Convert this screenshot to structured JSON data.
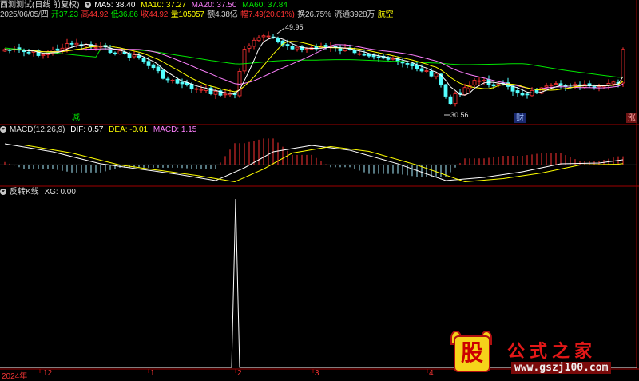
{
  "header": {
    "stock_title": "西测测试(日线 前复权)",
    "ma5": "MA5: 38.40",
    "ma10": "MA10: 37.27",
    "ma20": "MA20: 37.50",
    "ma60": "MA60: 37.84",
    "date": "2025/06/05/四",
    "open": "开37.23",
    "high": "高44.92",
    "low": "低36.86",
    "close": "收44.92",
    "volume": "量105057",
    "amount": "额4.38亿",
    "change": "幅7.49(20.01%)",
    "turnover": "换26.75%",
    "float": "流通3928万",
    "sector": "航空"
  },
  "price_panel": {
    "high_marker": "49.95",
    "low_marker": "30.56",
    "tag_left": "减",
    "tag_mid": "财",
    "tag_right": "涨"
  },
  "macd_panel": {
    "title": "MACD(12,26,9)",
    "dif": "DIF: 0.57",
    "dea": "DEA: -0.01",
    "macd": "MACD: 1.15"
  },
  "indicator_panel": {
    "title": "反转K线",
    "xg": "XG: 0.00"
  },
  "x_axis": {
    "labels": [
      "2024年",
      "12",
      "1",
      "2",
      "3",
      "4"
    ]
  },
  "watermark": {
    "icon_char": "股",
    "brand": "公式之家",
    "url": "www.gszj100.com"
  },
  "colors": {
    "up": "#ff3232",
    "down": "#54ffff",
    "ma5": "#ffffff",
    "ma10": "#ffff00",
    "ma20": "#ff80ff",
    "ma60": "#00e600",
    "axis": "#b00000"
  }
}
